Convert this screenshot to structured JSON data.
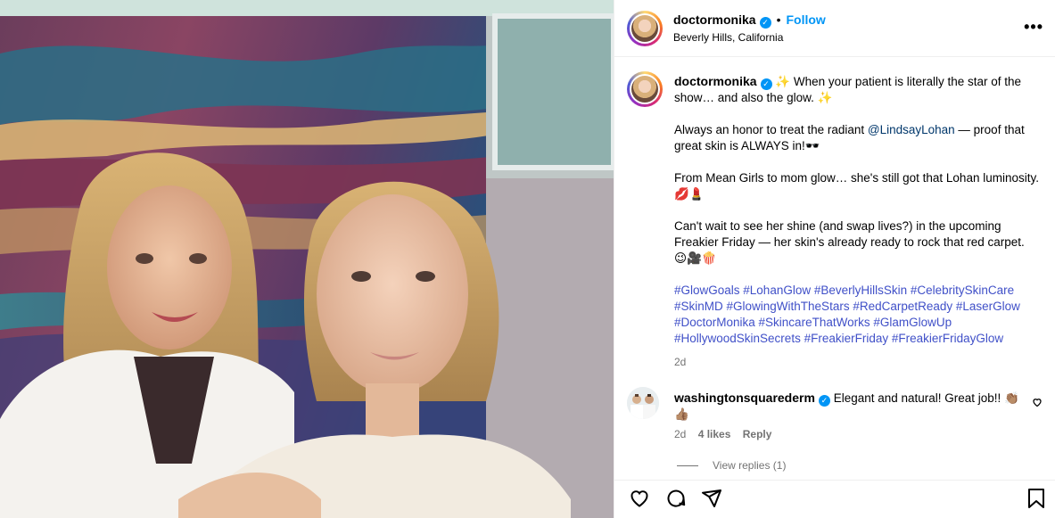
{
  "post": {
    "username": "doctormonika",
    "follow_label": "Follow",
    "dot": "•",
    "location": "Beverly Hills, California",
    "more_label": "•••",
    "verified_glyph": "✓"
  },
  "caption": {
    "username": "doctormonika",
    "line1": "✨ When your patient is literally the star of the show… and also the glow. ✨",
    "line2_before": "Always an honor to treat the radiant ",
    "mention": "@LindsayLohan",
    "line2_after": " — proof that great skin is ALWAYS in!🕶️",
    "line3": "From Mean Girls to mom glow… she's still got that Lohan luminosity. 💋💄",
    "line4": "Can't wait to see her shine (and swap lives?) in the upcoming Freakier Friday — her skin's already ready to rock that red carpet. 😉🎥🍿",
    "hashtags": "#GlowGoals #LohanGlow #BeverlyHillsSkin #CelebritySkinCare #SkinMD #GlowingWithTheStars #RedCarpetReady #LaserGlow #DoctorMonika #SkincareThatWorks #GlamGlowUp #HollywoodSkinSecrets #FreakierFriday #FreakierFridayGlow",
    "time": "2d"
  },
  "comment": {
    "username": "washingtonsquarederm",
    "text": "Elegant and natural! Great job!! 👏🏽👍🏽",
    "time": "2d",
    "likes": "4 likes",
    "reply_label": "Reply",
    "view_replies": "View replies (1)"
  },
  "icons": {
    "like": "heart-icon",
    "comment": "comment-icon",
    "share": "share-icon",
    "save": "bookmark-icon"
  },
  "colors": {
    "accent": "#0095f6",
    "hashtag": "#4050c8",
    "muted": "#737373"
  }
}
